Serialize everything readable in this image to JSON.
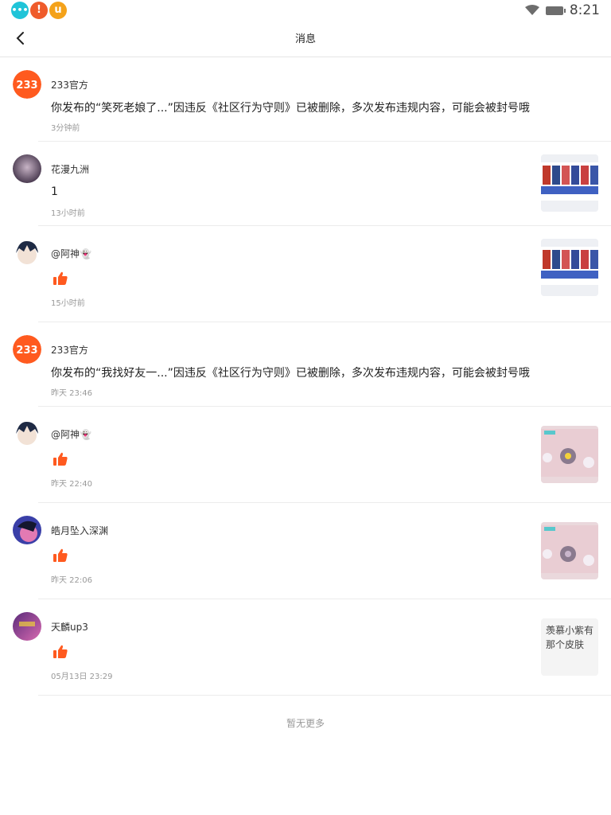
{
  "status_bar": {
    "time": "8:21",
    "notifications": [
      {
        "icon": "chat-bubble-icon",
        "glyph": "…",
        "color": "#20c4d8"
      },
      {
        "icon": "alert-icon",
        "glyph": "!",
        "color": "#ef5b2b"
      },
      {
        "icon": "u-app-icon",
        "glyph": "u",
        "color": "#f4a21a"
      }
    ]
  },
  "header": {
    "title": "消息",
    "back_icon": "chevron-left-icon"
  },
  "accent_color": "#ff5a1f",
  "messages": [
    {
      "avatar": "233-logo",
      "name": "233官方",
      "content": "你发布的“笑死老娘了...”因违反《社区行为守则》已被删除，多次发布违规内容，可能会被封号哦",
      "time": "3分钟前"
    },
    {
      "avatar": "user-avatar",
      "name": "花漫九洲",
      "content": "1",
      "time": "13小时前",
      "thumbnail": "image-thumbnail"
    },
    {
      "avatar": "user-avatar",
      "name": "@阿神👻",
      "like": "thumbs-up-icon",
      "time": "15小时前",
      "thumbnail": "image-thumbnail"
    },
    {
      "avatar": "233-logo",
      "name": "233官方",
      "content": "你发布的“我找好友一...”因违反《社区行为守则》已被删除，多次发布违规内容，可能会被封号哦",
      "time": "昨天 23:46"
    },
    {
      "avatar": "user-avatar",
      "name": "@阿神👻",
      "like": "thumbs-up-icon",
      "time": "昨天 22:40",
      "thumbnail": "image-thumbnail"
    },
    {
      "avatar": "user-avatar",
      "name": "皓月坠入深渊",
      "like": "thumbs-up-icon",
      "time": "昨天 22:06",
      "thumbnail": "image-thumbnail"
    },
    {
      "avatar": "user-avatar",
      "name": "天麟up3",
      "like": "thumbs-up-icon",
      "time": "05月13日 23:29",
      "thumbnail_text": "羡慕小紫有那个皮肤"
    }
  ],
  "footer": "暂无更多"
}
